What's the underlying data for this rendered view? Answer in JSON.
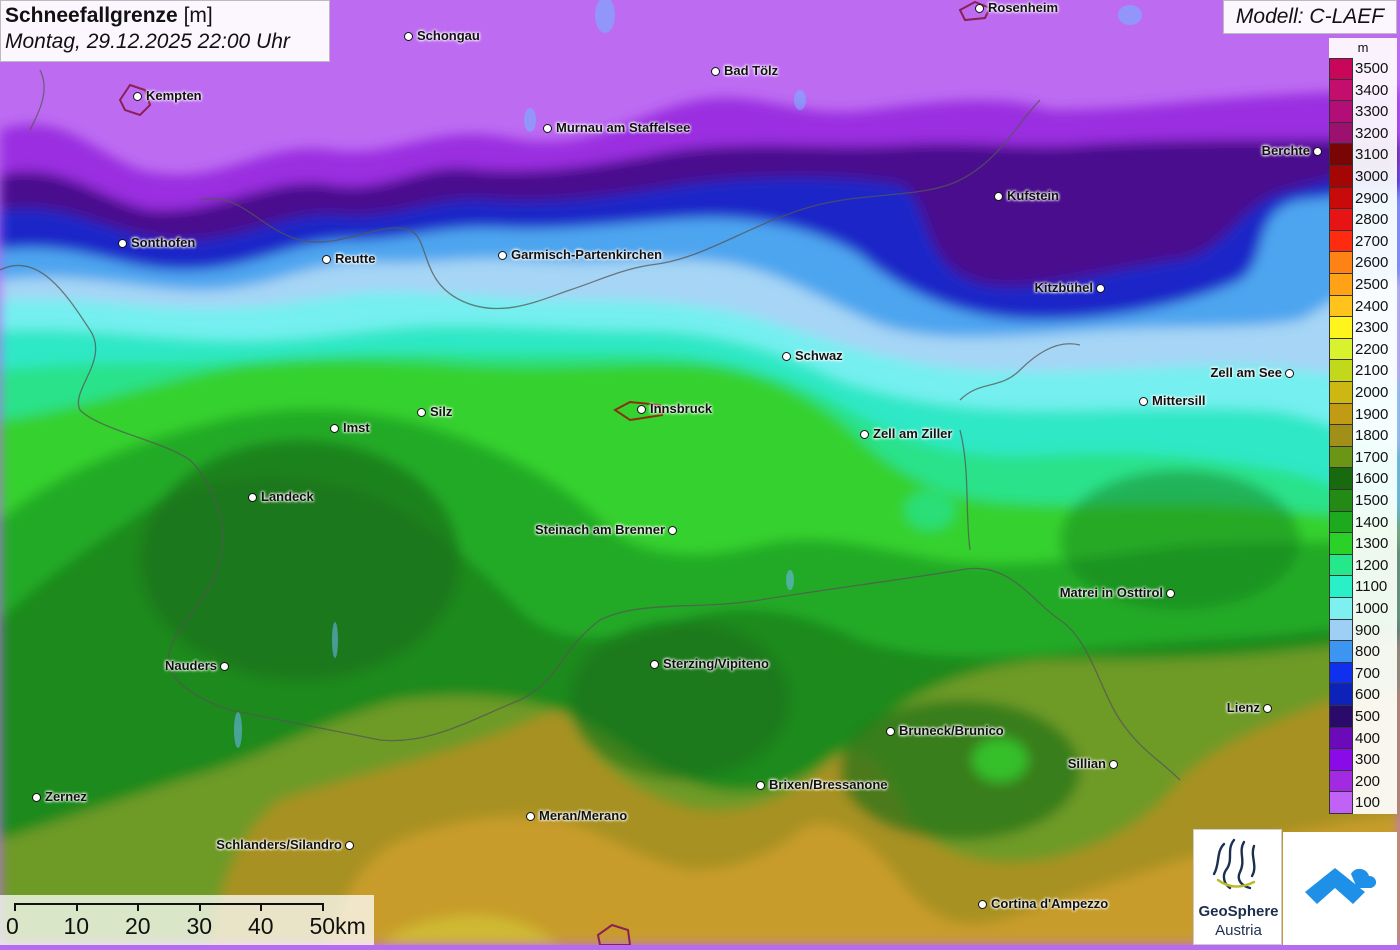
{
  "title": {
    "parameter": "Schneefallgrenze",
    "unit": "[m]",
    "datetime": "Montag, 29.12.2025 22:00 Uhr"
  },
  "model": "Modell: C-LAEF",
  "legend": {
    "unit": "m",
    "entries": [
      {
        "value": "3500",
        "color": "#c8075a"
      },
      {
        "value": "3400",
        "color": "#c40e6e"
      },
      {
        "value": "3300",
        "color": "#b30d78"
      },
      {
        "value": "3200",
        "color": "#9c1070"
      },
      {
        "value": "3100",
        "color": "#7a0505"
      },
      {
        "value": "3000",
        "color": "#a40505"
      },
      {
        "value": "2900",
        "color": "#c80a0a"
      },
      {
        "value": "2800",
        "color": "#e61414"
      },
      {
        "value": "2700",
        "color": "#ff2b10"
      },
      {
        "value": "2600",
        "color": "#ff8215"
      },
      {
        "value": "2500",
        "color": "#ffa216"
      },
      {
        "value": "2400",
        "color": "#ffc41c"
      },
      {
        "value": "2300",
        "color": "#fff51c"
      },
      {
        "value": "2200",
        "color": "#d8f22d"
      },
      {
        "value": "2100",
        "color": "#c2d81a"
      },
      {
        "value": "2000",
        "color": "#cdb713"
      },
      {
        "value": "1900",
        "color": "#c29b15"
      },
      {
        "value": "1800",
        "color": "#a0901a"
      },
      {
        "value": "1700",
        "color": "#6a9515"
      },
      {
        "value": "1600",
        "color": "#186a0f"
      },
      {
        "value": "1500",
        "color": "#238a15"
      },
      {
        "value": "1400",
        "color": "#1eaa1e"
      },
      {
        "value": "1300",
        "color": "#2ad228"
      },
      {
        "value": "1200",
        "color": "#24e88a"
      },
      {
        "value": "1100",
        "color": "#2af0c8"
      },
      {
        "value": "1000",
        "color": "#7ff0f0"
      },
      {
        "value": "900",
        "color": "#9ed0f5"
      },
      {
        "value": "800",
        "color": "#3c95f0"
      },
      {
        "value": "700",
        "color": "#1030f0"
      },
      {
        "value": "600",
        "color": "#0c22b8"
      },
      {
        "value": "500",
        "color": "#2a0a6a"
      },
      {
        "value": "400",
        "color": "#6a0ab8"
      },
      {
        "value": "300",
        "color": "#8a0ae8"
      },
      {
        "value": "200",
        "color": "#a22ae0"
      },
      {
        "value": "100",
        "color": "#c062f5"
      }
    ]
  },
  "cities": [
    {
      "name": "Rosenheim"
    },
    {
      "name": "Schongau"
    },
    {
      "name": "Kempten"
    },
    {
      "name": "Bad Tölz"
    },
    {
      "name": "Murnau am Staffelsee"
    },
    {
      "name": "Berchte"
    },
    {
      "name": "Kufstein"
    },
    {
      "name": "Sonthofen"
    },
    {
      "name": "Reutte"
    },
    {
      "name": "Garmisch-Partenkirchen"
    },
    {
      "name": "Kitzbühel"
    },
    {
      "name": "Schwaz"
    },
    {
      "name": "Zell am See"
    },
    {
      "name": "Mittersill"
    },
    {
      "name": "Innsbruck"
    },
    {
      "name": "Silz"
    },
    {
      "name": "Imst"
    },
    {
      "name": "Zell am Ziller"
    },
    {
      "name": "Landeck"
    },
    {
      "name": "Steinach am Brenner"
    },
    {
      "name": "Matrei in Osttirol"
    },
    {
      "name": "Nauders"
    },
    {
      "name": "Sterzing/Vipiteno"
    },
    {
      "name": "Lienz"
    },
    {
      "name": "Bruneck/Brunico"
    },
    {
      "name": "Sillian"
    },
    {
      "name": "Brixen/Bressanone"
    },
    {
      "name": "Zernez"
    },
    {
      "name": "Meran/Merano"
    },
    {
      "name": "Schlanders/Silandro"
    },
    {
      "name": "Cortina d'Ampezzo"
    }
  ],
  "scale": {
    "labels": [
      "0",
      "10",
      "20",
      "30",
      "40",
      "50km"
    ]
  },
  "logos": {
    "geosphere_name": "GeoSphere",
    "geosphere_sub": "Austria"
  }
}
